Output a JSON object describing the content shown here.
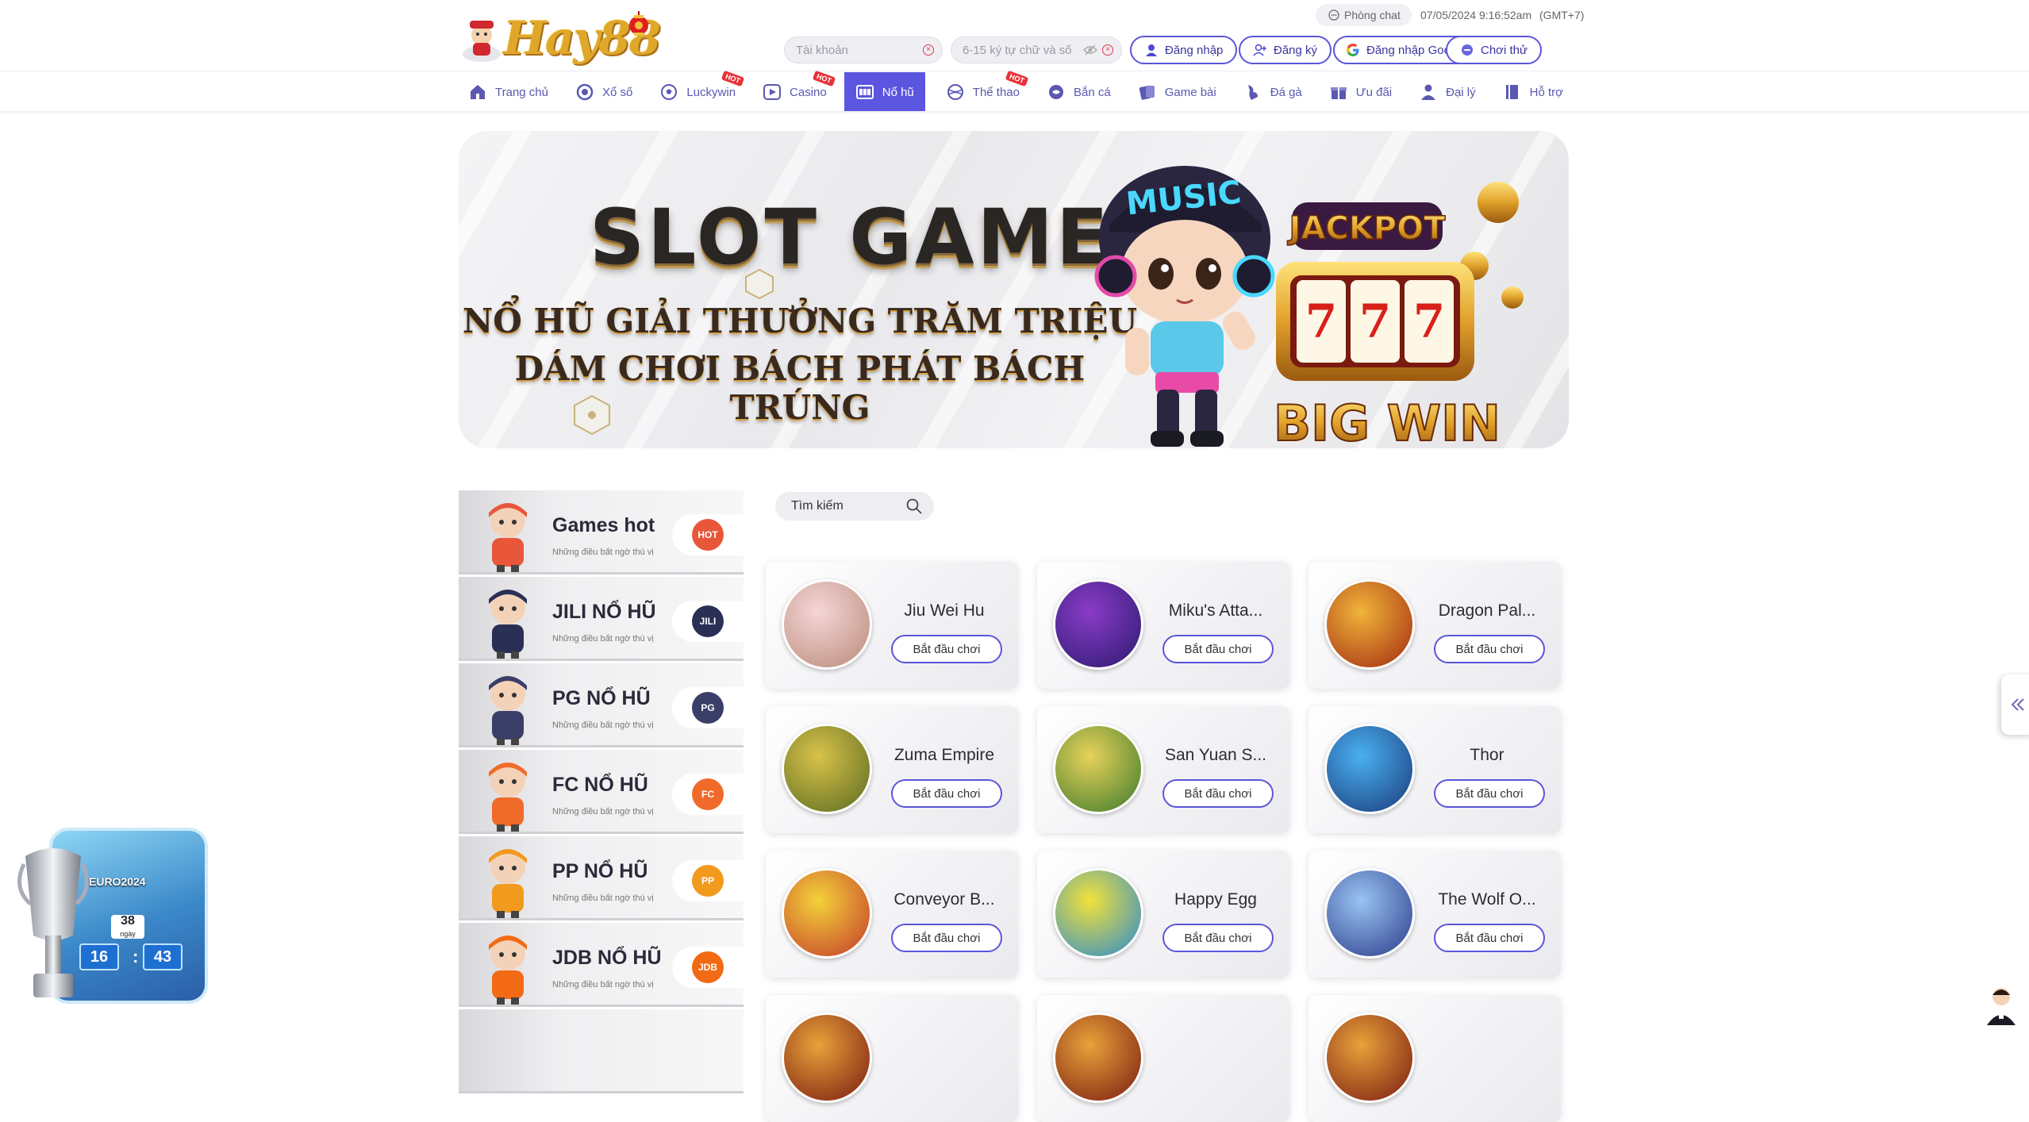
{
  "header": {
    "brand": "Hay88",
    "chat_label": "Phòng chat",
    "datetime": "07/05/2024 9:16:52am",
    "timezone": "(GMT+7)",
    "username_placeholder": "Tài khoản",
    "password_placeholder": "6-15 ký tự chữ và số",
    "login_label": "Đăng nhập",
    "register_label": "Đăng ký",
    "google_login_label": "Đăng nhập Google",
    "try_label": "Chơi thử"
  },
  "nav": [
    {
      "label": "Trang chủ",
      "icon": "home-icon"
    },
    {
      "label": "Xổ số",
      "icon": "lottery-icon"
    },
    {
      "label": "Luckywin",
      "icon": "soccer-icon",
      "hot": "HOT"
    },
    {
      "label": "Casino",
      "icon": "play-icon",
      "hot": "HOT"
    },
    {
      "label": "Nổ hũ",
      "icon": "slot-icon",
      "active": true
    },
    {
      "label": "Thể thao",
      "icon": "sports-icon",
      "hot": "HOT"
    },
    {
      "label": "Bắn cá",
      "icon": "fish-icon"
    },
    {
      "label": "Game bài",
      "icon": "cards-icon"
    },
    {
      "label": "Đá gà",
      "icon": "rooster-icon"
    },
    {
      "label": "Ưu đãi",
      "icon": "gift-icon"
    },
    {
      "label": "Đại lý",
      "icon": "agent-icon"
    },
    {
      "label": "Hỗ trợ",
      "icon": "support-icon"
    }
  ],
  "banner": {
    "title": "SLOT GAMES",
    "line1": "NỔ HŨ GIẢI THƯỞNG TRĂM TRIỆU",
    "line2": "DÁM CHƠI BÁCH PHÁT BÁCH TRÚNG",
    "jackpot": "JACKPOT",
    "reels": "777",
    "bigwin": "BIG WIN",
    "cap_text": "MUSIC"
  },
  "categories": [
    {
      "name": "Games hot",
      "desc": "Những điều bất ngờ thú vị",
      "badge": "HOT",
      "color": "#e8573a"
    },
    {
      "name": "JILI NỔ HŨ",
      "desc": "Những điều bất ngờ thú vị",
      "badge": "JILI",
      "color": "#2a2f55"
    },
    {
      "name": "PG NỔ HŨ",
      "desc": "Những điều bất ngờ thú vị",
      "badge": "PG",
      "color": "#3a3f6a"
    },
    {
      "name": "FC NỔ HŨ",
      "desc": "Những điều bất ngờ thú vị",
      "badge": "FC",
      "color": "#f06a2a"
    },
    {
      "name": "PP NỔ HŨ",
      "desc": "Những điều bất ngờ thú vị",
      "badge": "PP",
      "color": "#f29a1e"
    },
    {
      "name": "JDB NỔ HŨ",
      "desc": "Những điều bất ngờ thú vị",
      "badge": "JDB",
      "color": "#f26a14"
    }
  ],
  "search": {
    "placeholder": "Tìm kiếm"
  },
  "play_label": "Bắt đầu chơi",
  "games": [
    {
      "name": "Jiu Wei Hu",
      "c1": "#f6d6d8",
      "c2": "#b98a78"
    },
    {
      "name": "Miku's Atta...",
      "c1": "#8a3cc8",
      "c2": "#2b1a6e"
    },
    {
      "name": "Dragon Pal...",
      "c1": "#f0b43a",
      "c2": "#a22a10"
    },
    {
      "name": "Zuma Empire",
      "c1": "#d8c24a",
      "c2": "#5a6a20"
    },
    {
      "name": "San Yuan S...",
      "c1": "#e8d25a",
      "c2": "#3a7a2a"
    },
    {
      "name": "Thor",
      "c1": "#4ab0f0",
      "c2": "#1a3a7a"
    },
    {
      "name": "Conveyor B...",
      "c1": "#f4d23a",
      "c2": "#c23a2a"
    },
    {
      "name": "Happy Egg",
      "c1": "#f2e23a",
      "c2": "#2a8ad0"
    },
    {
      "name": "The Wolf O...",
      "c1": "#9ac4f2",
      "c2": "#2a3a8a"
    }
  ],
  "euro": {
    "title": "EURO2024",
    "days": "38",
    "days_label": "ngày",
    "hours": "16",
    "minutes": "43"
  }
}
